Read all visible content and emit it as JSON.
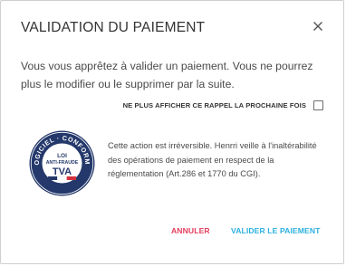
{
  "dialog": {
    "title": "VALIDATION DU PAIEMENT",
    "message": "Vous vous apprêtez à valider un paiement. Vous ne pourrez plus le modifier ou le supprimer par la suite.",
    "dont_show_again_label": "NE PLUS AFFICHER CE RAPPEL LA PROCHAINE FOIS",
    "dont_show_again_checked": false,
    "info_text": "Cette action est irréversible. Henrri veille à l'inaltérabilité des opérations de paiement en respect de la réglementation (Art.286 et 1770 du CGI).",
    "badge": {
      "arc_text": "LOGICIEL · CONFORME",
      "line1": "LOI",
      "line2": "ANTI-FRAUDE",
      "line3": "TVA"
    },
    "cancel_label": "ANNULER",
    "confirm_label": "VALIDER LE PAIEMENT"
  },
  "colors": {
    "cancel": "#e23c5c",
    "confirm": "#2bb0df",
    "badge_navy": "#24386b",
    "badge_red": "#d2323c"
  },
  "icons": {
    "close": "close-icon",
    "badge": "anti-fraud-seal-icon"
  }
}
